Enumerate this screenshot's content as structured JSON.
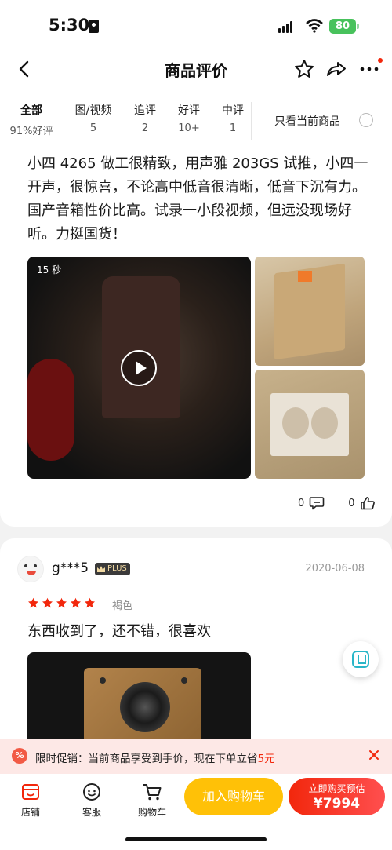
{
  "status_bar": {
    "time": "5:30",
    "battery": "80"
  },
  "header": {
    "title": "商品评价"
  },
  "filters": {
    "tabs": [
      {
        "label": "全部",
        "count": "91%好评"
      },
      {
        "label": "图/视频",
        "count": "5"
      },
      {
        "label": "追评",
        "count": "2"
      },
      {
        "label": "好评",
        "count": "10+"
      },
      {
        "label": "中评",
        "count": "1"
      }
    ],
    "only_current_label": "只看当前商品"
  },
  "review1": {
    "text": "小四 4265 做工很精致，用声雅 203GS 试推，小四一开声，很惊喜，不论高中低音很清晰，低音下沉有力。国产音箱性价比高。试录一小段视频，但远没现场好听。力挺国货！",
    "video_duration": "15 秒",
    "comment_count": "0",
    "like_count": "0"
  },
  "review2": {
    "username": "g***5",
    "badge": "PLUS",
    "date": "2020-06-08",
    "rating": 5,
    "variant": "褐色",
    "text": "东西收到了，还不错，很喜欢"
  },
  "promo": {
    "icon_text": "%",
    "prefix": "限时促销：当前商品享受到手价，现在下单立省",
    "amount": "5元"
  },
  "bottom_bar": {
    "store_label": "店铺",
    "service_label": "客服",
    "cart_label": "购物车",
    "add_to_cart_label": "加入购物车",
    "buy_now_label": "立即购买预估",
    "buy_now_price": "¥7994"
  },
  "colors": {
    "accent_red": "#f2270c",
    "cart_yellow": "#ffc107",
    "star_red": "#f2270c",
    "battery_green": "#48c25c"
  }
}
